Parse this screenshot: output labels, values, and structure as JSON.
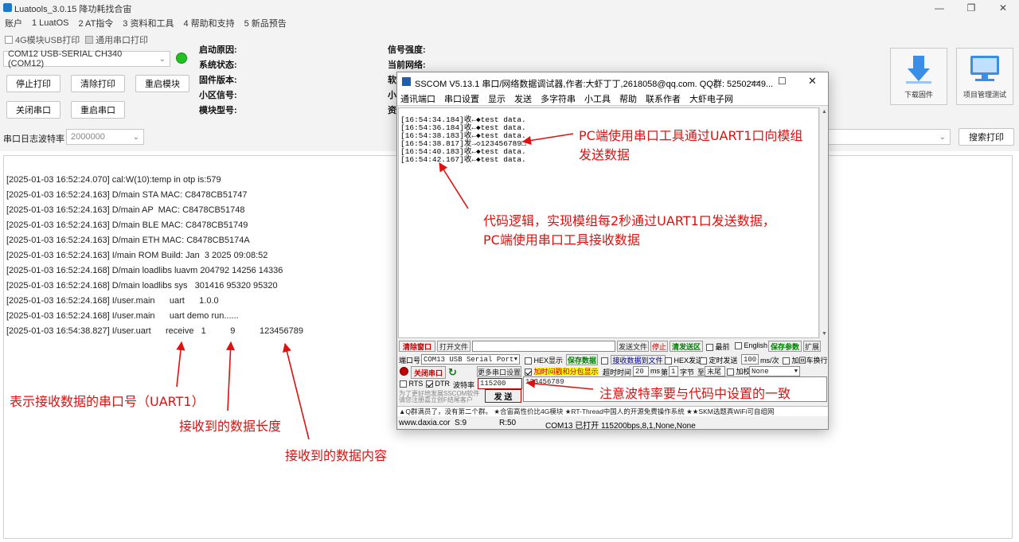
{
  "app": {
    "title": "Luatools_3.0.15 降功耗找合宙",
    "menu": [
      "账户",
      "1 LuatOS",
      "2 AT指令",
      "3 资料和工具",
      "4 帮助和支持",
      "5 新品预告"
    ]
  },
  "options": {
    "usb_print": "4G模块USB打印",
    "serial_print": "通用串口打印"
  },
  "port": {
    "selected": "COM12 USB-SERIAL CH340 (COM12)"
  },
  "buttons": {
    "stop_print": "停止打印",
    "clear_print": "清除打印",
    "reboot_module": "重启模块",
    "close_port": "关闭串口",
    "reopen_port": "重启串口",
    "search_print": "搜索打印",
    "download_fw": "下载固件",
    "project_mgmt": "项目管理测试"
  },
  "status_labels": {
    "boot_reason": "启动原因:",
    "sys_status": "系统状态:",
    "fw_version": "固件版本:",
    "cell_signal": "小区信号:",
    "module_model": "模块型号:",
    "signal_strength": "信号强度:",
    "current_network": "当前网络:",
    "r3": "软",
    "r4": "小",
    "r5": "资"
  },
  "baud": {
    "label": "串口日志波特率",
    "value": "2000000"
  },
  "log_lines": [
    "[2025-01-03 16:52:24.070] cal:W(10):temp in otp is:579",
    "[2025-01-03 16:52:24.163] D/main STA MAC: C8478CB51747",
    "[2025-01-03 16:52:24.163] D/main AP  MAC: C8478CB51748",
    "[2025-01-03 16:52:24.163] D/main BLE MAC: C8478CB51749",
    "[2025-01-03 16:52:24.163] D/main ETH MAC: C8478CB5174A",
    "[2025-01-03 16:52:24.163] I/main ROM Build: Jan  3 2025 09:08:52",
    "[2025-01-03 16:52:24.168] D/main loadlibs luavm 204792 14256 14336",
    "[2025-01-03 16:52:24.168] D/main loadlibs sys   301416 95320 95320",
    "[2025-01-03 16:52:24.168] I/user.main      uart      1.0.0",
    "[2025-01-03 16:52:24.168] I/user.main      uart demo run......",
    "[2025-01-03 16:54:38.827] I/user.uart      receive   1          9          123456789"
  ],
  "sscom": {
    "title": "SSCOM V5.13.1 串口/网络数据调试器,作者:大虾丁丁,2618058@qq.com. QQ群: 52502449...",
    "menu": [
      "通讯端口",
      "串口设置",
      "显示",
      "发送",
      "多字符串",
      "小工具",
      "帮助",
      "联系作者",
      "大虾电子网"
    ],
    "rx_lines": [
      "[16:54:34.184]收←◆test data.",
      "[16:54:36.184]收←◆test data.",
      "[16:54:38.183]收←◆test data.",
      "[16:54:38.817]发→◇123456789□",
      "[16:54:40.183]收←◆test data.",
      "[16:54:42.167]收←◆test data."
    ],
    "row1": {
      "clear": "清除窗口",
      "open_file": "打开文件",
      "send_file": "发送文件",
      "stop": "停止",
      "clear_send": "清发送区",
      "front": "最前",
      "english": "English",
      "save_params": "保存参数",
      "expand": "扩展"
    },
    "port_label": "端口号",
    "port_value": "COM13 USB Serial Port",
    "hex_show": "HEX显示",
    "save_data": "保存数据",
    "recv_to_file": "接收数据到文件",
    "hex_send": "HEX发送",
    "timed_send": "定时发送",
    "interval": "100",
    "interval_unit": "ms/次",
    "add_crlf": "加回车换行",
    "close_port": "关闭串口",
    "more_settings": "更多串口设置",
    "add_timestamp": "加时间戳和分包显示",
    "timeout_label": "超时时间",
    "timeout_value": "20",
    "timeout_unit": "ms",
    "pkt_prefix": "第",
    "pkt_value": "1",
    "pkt_unit": "字节",
    "to": "至",
    "end": "末尾",
    "checksum_label": "加校验",
    "checksum_value": "None",
    "rts": "RTS",
    "dtr": "DTR",
    "baud_label": "波特率",
    "baud_value": "115200",
    "send_text": "123456789",
    "send_btn": "发 送",
    "promo1": "为了更好地发展SSCOM软件",
    "promo2": "请您注册嘉立创F结尾客户",
    "ticker": "▲Q群满员了，没有第二个群。  ★合宙高性价比4G模块  ★RT-Thread中国人的开源免费操作系统  ★★SKM选题真WiFi可自组网",
    "status": {
      "site": "www.daxia.cor",
      "s": "S:9",
      "r": "R:50",
      "info": "COM13 已打开  115200bps,8,1,None,None"
    }
  },
  "annotations": {
    "pc_send": "PC端使用串口工具通过UART1口向模组",
    "pc_send2": "发送数据",
    "code_logic": "代码逻辑，实现模组每2秒通过UART1口发送数据，",
    "code_logic2": "PC端使用串口工具接收数据",
    "baud_note": "注意波特率要与代码中设置的一致",
    "uart_id": "表示接收数据的串口号（UART1）",
    "data_len": "接收到的数据长度",
    "data_content": "接收到的数据内容"
  },
  "colors": {
    "annotation": "#e01010",
    "led": "#22c022"
  }
}
